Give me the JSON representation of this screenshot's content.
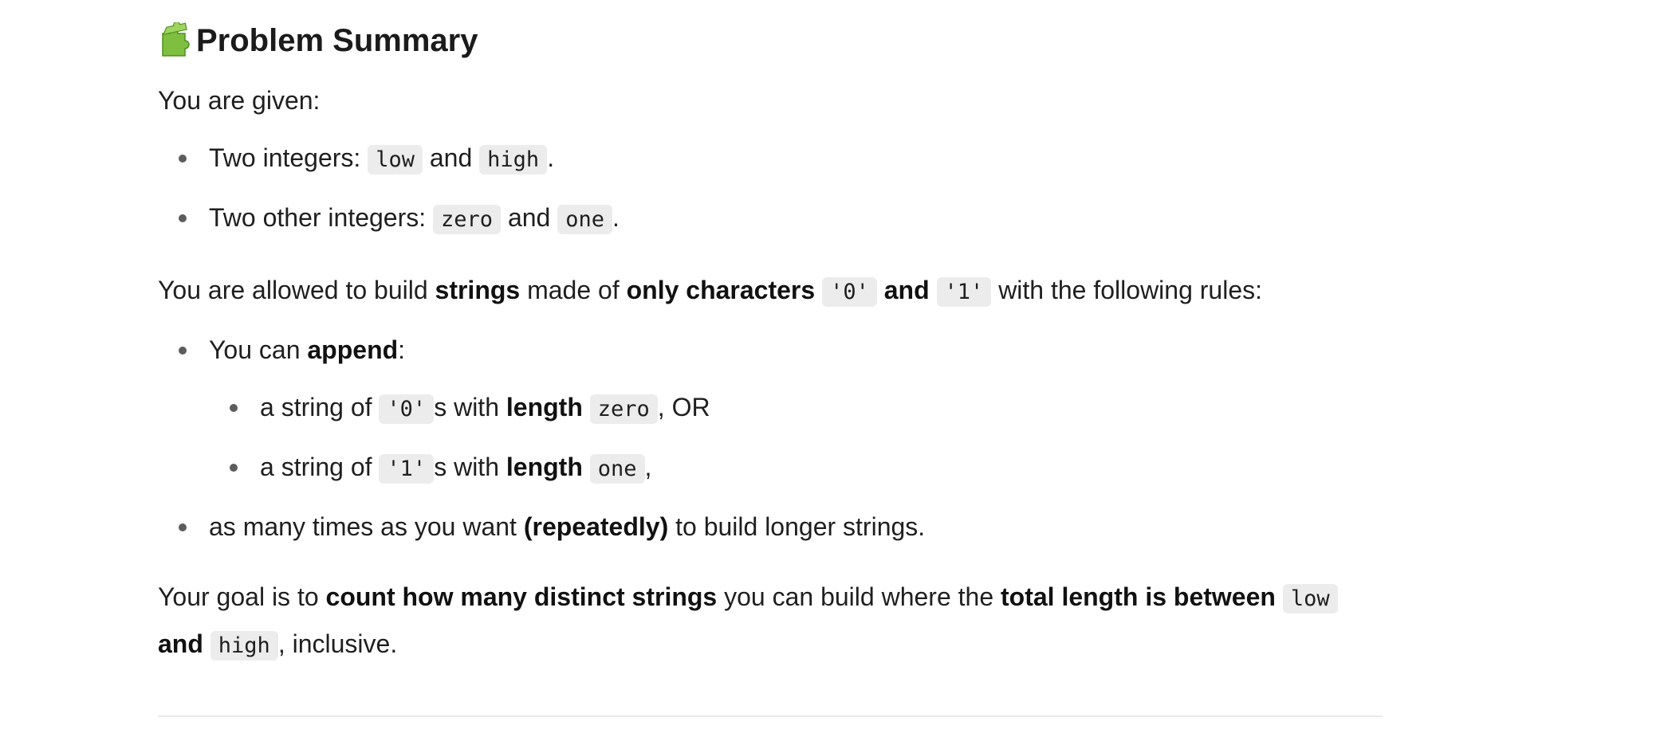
{
  "heading": {
    "icon": "puzzle-piece-icon",
    "title": "Problem Summary"
  },
  "intro": "You are given:",
  "given_items": [
    {
      "prefix": "Two integers: ",
      "code1": "low",
      "mid": " and ",
      "code2": "high",
      "suffix": "."
    },
    {
      "prefix": "Two other integers: ",
      "code1": "zero",
      "mid": " and ",
      "code2": "one",
      "suffix": "."
    }
  ],
  "rules_para": {
    "t1": "You are allowed to build ",
    "b1": "strings",
    "t2": " made of ",
    "b2": "only characters",
    "code1": "'0'",
    "b3": "and",
    "code2": "'1'",
    "t3": " with the following rules:"
  },
  "append_item": {
    "t1": "You can ",
    "b1": "append",
    "t2": ":"
  },
  "nested_items": [
    {
      "t1": "a string of ",
      "code1": "'0'",
      "t2": "s with ",
      "b1": "length",
      "code2": "zero",
      "t3": ", OR"
    },
    {
      "t1": "a string of ",
      "code1": "'1'",
      "t2": "s with ",
      "b1": "length",
      "code2": "one",
      "t3": ","
    }
  ],
  "repeat_item": {
    "t1": "as many times as you want ",
    "b1": "(repeatedly)",
    "t2": " to build longer strings."
  },
  "goal_para": {
    "t1": "Your goal is to ",
    "b1": "count how many distinct strings",
    "t2": " you can build where the ",
    "b2": "total length is between",
    "code1": "low",
    "b3": "and",
    "code2": "high",
    "t3": ", inclusive."
  }
}
